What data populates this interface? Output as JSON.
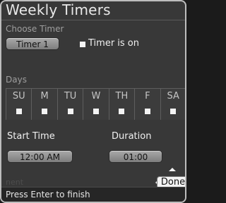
{
  "dialog": {
    "title": "Weekly Timers",
    "choose_label": "Choose Timer",
    "timer_selector": "Timer 1",
    "timer_on_label": "Timer is on",
    "days_label": "Days",
    "days": [
      "SU",
      "M",
      "TU",
      "W",
      "TH",
      "F",
      "SA"
    ],
    "start_time_label": "Start Time",
    "start_time_value": "12:00 AM",
    "duration_label": "Duration",
    "duration_value": "01:00",
    "ghost_text": "nent",
    "done_label": "Done",
    "status": "Press Enter to finish"
  }
}
